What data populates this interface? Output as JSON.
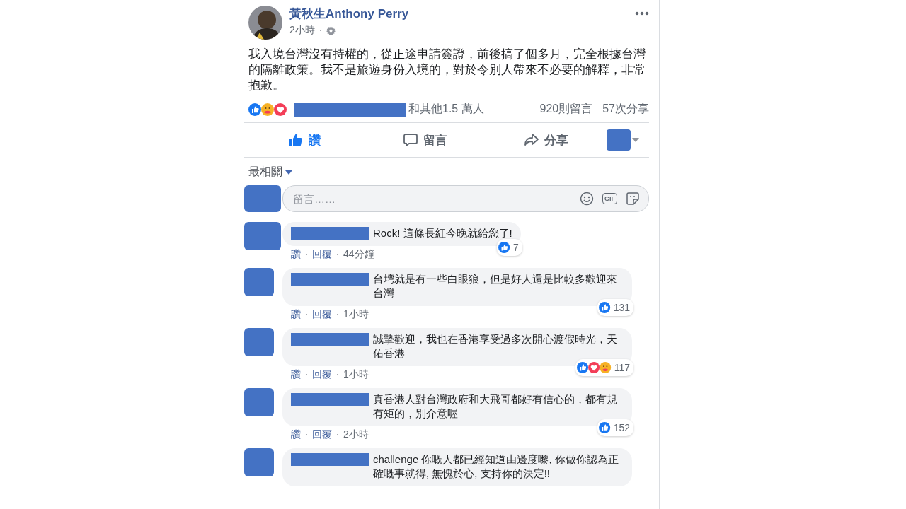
{
  "post": {
    "author": "黃秋生Anthony Perry",
    "time": "2小時",
    "text": "我入境台灣沒有持權的，從正途申請簽證，前後搞了個多月，完全根據台灣的隔離政策。我不是旅遊身份入境的，對於令別人帶來不必要的解釋，非常抱歉。",
    "reactions": [
      {
        "kind": "like"
      },
      {
        "kind": "care"
      },
      {
        "kind": "love"
      }
    ],
    "reactions_text": "和其他1.5 萬人",
    "comments_count": "920則留言",
    "shares_count": "57次分享"
  },
  "actions": [
    {
      "kind": "like",
      "label": "讚"
    },
    {
      "kind": "comment",
      "label": "留言"
    },
    {
      "kind": "share",
      "label": "分享"
    }
  ],
  "sort": {
    "label": "最相關"
  },
  "composer": {
    "placeholder": "留言……",
    "gif_label": "GIF"
  },
  "comments": [
    {
      "text": "Rock! 這條長紅今晚就給您了!",
      "like_label": "讚",
      "reply_label": "回覆",
      "time": "44分鐘",
      "reactions": [
        {
          "kind": "like"
        }
      ],
      "count": "7"
    },
    {
      "text": "台塆就是有一些白眼狼，但是好人還是比較多歡迎來台灣",
      "like_label": "讚",
      "reply_label": "回覆",
      "time": "1小時",
      "reactions": [
        {
          "kind": "like"
        }
      ],
      "count": "131"
    },
    {
      "text": "誠摯歡迎，我也在香港享受過多次開心渡假時光，天佑香港",
      "like_label": "讚",
      "reply_label": "回覆",
      "time": "1小時",
      "reactions": [
        {
          "kind": "like"
        },
        {
          "kind": "love"
        },
        {
          "kind": "care"
        }
      ],
      "count": "117"
    },
    {
      "text": "真香港人對台灣政府和大飛哥都好有信心的，都有規有矩的，別介意喔",
      "like_label": "讚",
      "reply_label": "回覆",
      "time": "2小時",
      "reactions": [
        {
          "kind": "like"
        }
      ],
      "count": "152"
    },
    {
      "text": "challenge 你嘅人都已經知道由邊度嚟, 你做你認為正確嘅事就得, 無愧於心, 支持你的決定!!"
    }
  ]
}
